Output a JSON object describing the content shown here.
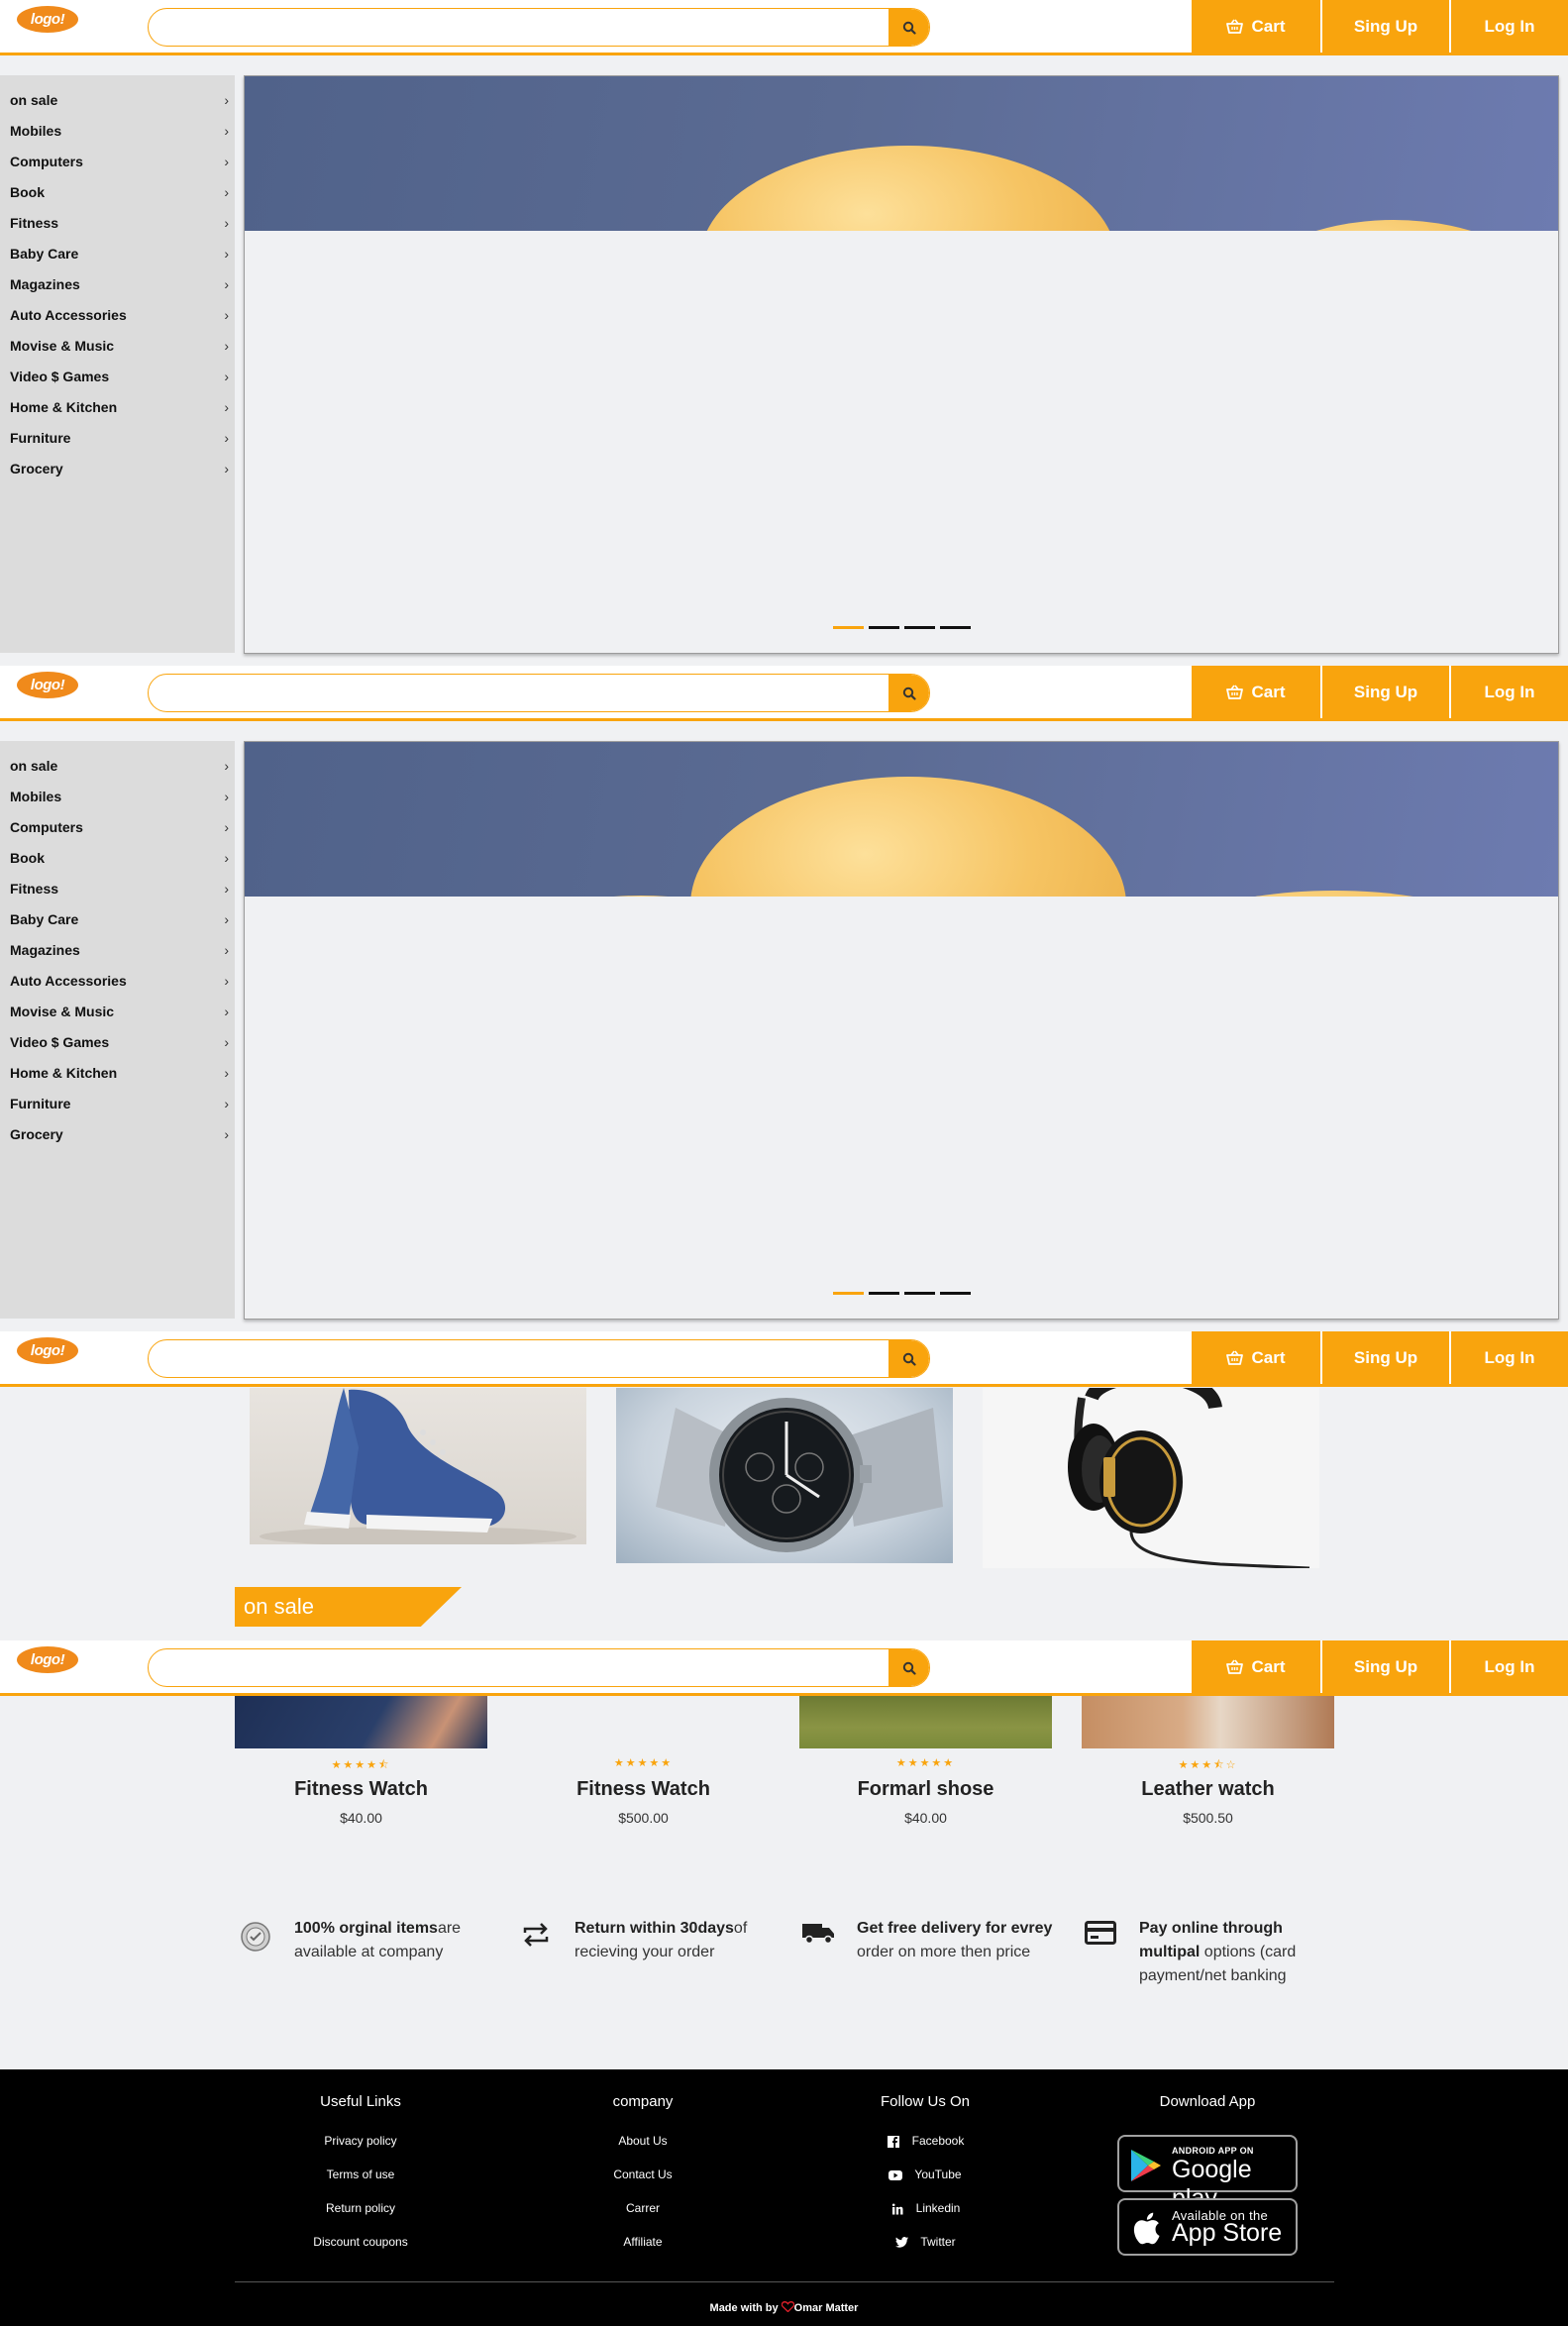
{
  "header": {
    "logo_text": "logo!",
    "search_placeholder": "",
    "cart_label": "Cart",
    "signup_label": "Sing Up",
    "login_label": "Log In"
  },
  "categories": [
    {
      "label": "on sale"
    },
    {
      "label": "Mobiles"
    },
    {
      "label": "Computers"
    },
    {
      "label": "Book"
    },
    {
      "label": "Fitness"
    },
    {
      "label": "Baby Care"
    },
    {
      "label": "Magazines"
    },
    {
      "label": "Auto Accessories"
    },
    {
      "label": "Movise & Music"
    },
    {
      "label": "Video $ Games"
    },
    {
      "label": "Home & Kitchen"
    },
    {
      "label": "Furniture"
    },
    {
      "label": "Grocery"
    }
  ],
  "carousel": {
    "slide_count": 4,
    "active_slide": 1
  },
  "section_heading": "on sale",
  "products": [
    {
      "name": "Fitness Watch",
      "price": "$40.00",
      "rating": 4.5
    },
    {
      "name": "Fitness Watch",
      "price": "$500.00",
      "rating": 5
    },
    {
      "name": "Formarl shose",
      "price": "$40.00",
      "rating": 5
    },
    {
      "name": "Leather watch",
      "price": "$500.50",
      "rating": 3.5
    }
  ],
  "features": [
    {
      "icon": "quality-seal-icon",
      "bold": "100% orginal items",
      "text": "are available at company"
    },
    {
      "icon": "return-arrows-icon",
      "bold": "Return within 30days",
      "text": "of recieving your order"
    },
    {
      "icon": "delivery-truck-icon",
      "bold_pre": "Get free delivery for ",
      "bold": "evrey",
      "text": " order on more then price"
    },
    {
      "icon": "credit-card-icon",
      "bold_pre": "Pay online through ",
      "bold": "multipal",
      "text": " options (card payment/net banking"
    }
  ],
  "footer": {
    "useful_links": {
      "title": "Useful Links",
      "items": [
        "Privacy policy",
        "Terms of use",
        "Return policy",
        "Discount coupons"
      ]
    },
    "company": {
      "title": "company",
      "items": [
        "About Us",
        "Contact Us",
        "Carrer",
        "Affiliate"
      ]
    },
    "follow": {
      "title": "Follow Us On",
      "items": [
        {
          "label": "Facebook",
          "icon": "facebook-icon"
        },
        {
          "label": "YouTube",
          "icon": "youtube-icon"
        },
        {
          "label": "Linkedin",
          "icon": "linkedin-icon"
        },
        {
          "label": "Twitter",
          "icon": "twitter-icon"
        }
      ]
    },
    "download": {
      "title": "Download App",
      "google_small": "ANDROID APP ON",
      "google_big": "Google play",
      "apple_small": "Available on the",
      "apple_big": "App Store"
    },
    "made_with": "Made with by",
    "author": "Omar Matter"
  },
  "colors": {
    "accent": "#f9a40d",
    "sidebar": "#dcdcdc",
    "footer": "#000000",
    "page": "#f0f1f3"
  }
}
